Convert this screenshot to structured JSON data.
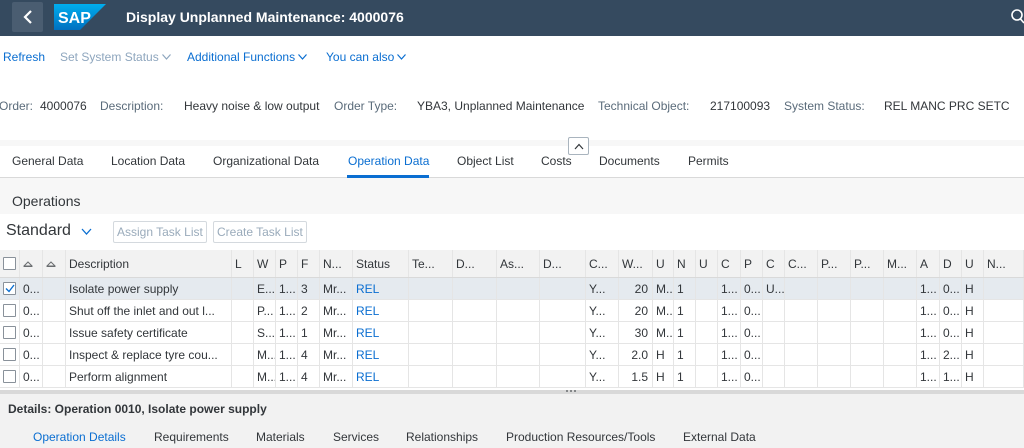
{
  "shell": {
    "logo_text": "SAP",
    "title": "Display Unplanned Maintenance: 4000076",
    "colors": {
      "shell_bg": "#354a5f",
      "accent": "#0a6ed1"
    }
  },
  "toolbar": {
    "refresh": "Refresh",
    "set_system_status": "Set System Status",
    "additional_functions": "Additional Functions",
    "you_can_also": "You can also"
  },
  "header_info": {
    "order_label": "Order:",
    "order_value": "4000076",
    "description_label": "Description:",
    "description_value": "Heavy noise & low output",
    "order_type_label": "Order Type:",
    "order_type_value": "YBA3, Unplanned Maintenance",
    "technical_object_label": "Technical Object:",
    "technical_object_value": "217100093",
    "system_status_label": "System Status:",
    "system_status_value": "REL  MANC PRC  SETC"
  },
  "tabs": [
    "General Data",
    "Location Data",
    "Organizational Data",
    "Operation Data",
    "Object List",
    "Costs",
    "Documents",
    "Permits"
  ],
  "active_tab": "Operation Data",
  "operations": {
    "section_title": "Operations",
    "variant": "Standard",
    "assign_task_list": "Assign Task List",
    "create_task_list": "Create Task List",
    "columns": [
      "",
      "",
      "",
      "Description",
      "L",
      "W",
      "P",
      "F",
      "N...",
      "Status",
      "Te...",
      "D...",
      "As...",
      "D...",
      "C...",
      "W...",
      "U",
      "N",
      "U",
      "C",
      "P",
      "C",
      "C...",
      "P...",
      "P...",
      "M...",
      "A",
      "D",
      "U",
      "N..."
    ],
    "rows": [
      [
        "0...",
        "",
        "Isolate power supply",
        "",
        "E...",
        "1...",
        "3",
        "Mr...",
        "REL",
        "",
        "",
        "",
        "",
        "Y...",
        "20",
        "M...",
        "1",
        "",
        "1...",
        "0...",
        "U...",
        "",
        "",
        "",
        "",
        "1...",
        "0...",
        "H",
        ""
      ],
      [
        "0...",
        "",
        "Shut off the inlet and out l...",
        "",
        "P...",
        "1...",
        "2",
        "Mr...",
        "REL",
        "",
        "",
        "",
        "",
        "Y...",
        "20",
        "M...",
        "1",
        "",
        "1...",
        "0...",
        "",
        "",
        "",
        "",
        "",
        "1...",
        "0...",
        "H",
        ""
      ],
      [
        "0...",
        "",
        "Issue safety certificate",
        "",
        "S...",
        "1...",
        "1",
        "Mr...",
        "REL",
        "",
        "",
        "",
        "",
        "Y...",
        "30",
        "M...",
        "1",
        "",
        "1...",
        "0...",
        "",
        "",
        "",
        "",
        "",
        "1...",
        "0...",
        "H",
        ""
      ],
      [
        "0...",
        "",
        "Inspect & replace tyre cou...",
        "",
        "M...",
        "1...",
        "4",
        "Mr...",
        "REL",
        "",
        "",
        "",
        "",
        "Y...",
        "2.0",
        "H",
        "1",
        "",
        "1...",
        "0...",
        "",
        "",
        "",
        "",
        "",
        "1...",
        "2...",
        "H",
        ""
      ],
      [
        "0...",
        "",
        "Perform alignment",
        "",
        "M...",
        "1...",
        "4",
        "Mr...",
        "REL",
        "",
        "",
        "",
        "",
        "Y...",
        "1.5",
        "H",
        "1",
        "",
        "1...",
        "0...",
        "",
        "",
        "",
        "",
        "",
        "1...",
        "1...",
        "H",
        ""
      ]
    ],
    "selected_row": 0
  },
  "details": {
    "title": "Details: Operation 0010, Isolate power supply",
    "tabs": [
      "Operation Details",
      "Requirements",
      "Materials",
      "Services",
      "Relationships",
      "Production Resources/Tools",
      "External Data"
    ],
    "active_tab": "Operation Details"
  }
}
